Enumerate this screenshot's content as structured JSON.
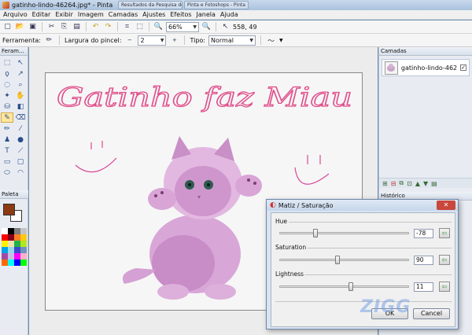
{
  "window": {
    "title": "gatinho-lindo-46264.jpg* - Pinta",
    "taskbar_tabs": [
      "Resultados da Pesquisa de imagens do G...",
      "Pinta e Fotoshops - Pinta"
    ]
  },
  "menu": [
    "Arquivo",
    "Editar",
    "Exibir",
    "Imagem",
    "Camadas",
    "Ajustes",
    "Efeitos",
    "Janela",
    "Ajuda"
  ],
  "toolbar": {
    "zoom": "66%",
    "cursor_pos": "558, 49"
  },
  "tool_options": {
    "tool_label": "Ferramenta:",
    "brush_width_label": "Largura do pincel:",
    "brush_width": "2",
    "type_label": "Tipo:",
    "type_value": "Normal"
  },
  "panels": {
    "tools_title": "Feram...",
    "palette_title": "Paleta",
    "layers_title": "Camadas",
    "history_title": "Histórico"
  },
  "layers": [
    {
      "name": "gatinho-lindo-462",
      "visible": true
    }
  ],
  "canvas": {
    "handwriting": "Gatinho faz Miau"
  },
  "palette_colors": {
    "primary": "#8b3a12",
    "secondary": "#ffffff",
    "swatches": [
      "#ffffff",
      "#000000",
      "#7f7f7f",
      "#c3c3c3",
      "#ff0000",
      "#880015",
      "#ff7f27",
      "#ffc90e",
      "#fff200",
      "#efe4b0",
      "#22b14c",
      "#b5e61d",
      "#00a2e8",
      "#99d9ea",
      "#3f48cc",
      "#7092be",
      "#a349a4",
      "#c8bfe7",
      "#ff00ff",
      "#ffaec9",
      "#ff6a00",
      "#00ffff",
      "#0000ff",
      "#00ff00"
    ]
  },
  "dialog": {
    "title": "Matiz / Saturação",
    "hue_label": "Hue",
    "hue_value": "-78",
    "hue_level": 0.28,
    "saturation_label": "Saturation",
    "saturation_value": "90",
    "saturation_level": 0.45,
    "lightness_label": "Lightness",
    "lightness_value": "11",
    "lightness_level": 0.55,
    "ok_label": "OK",
    "cancel_label": "Cancel"
  },
  "watermark": "ZIGG"
}
